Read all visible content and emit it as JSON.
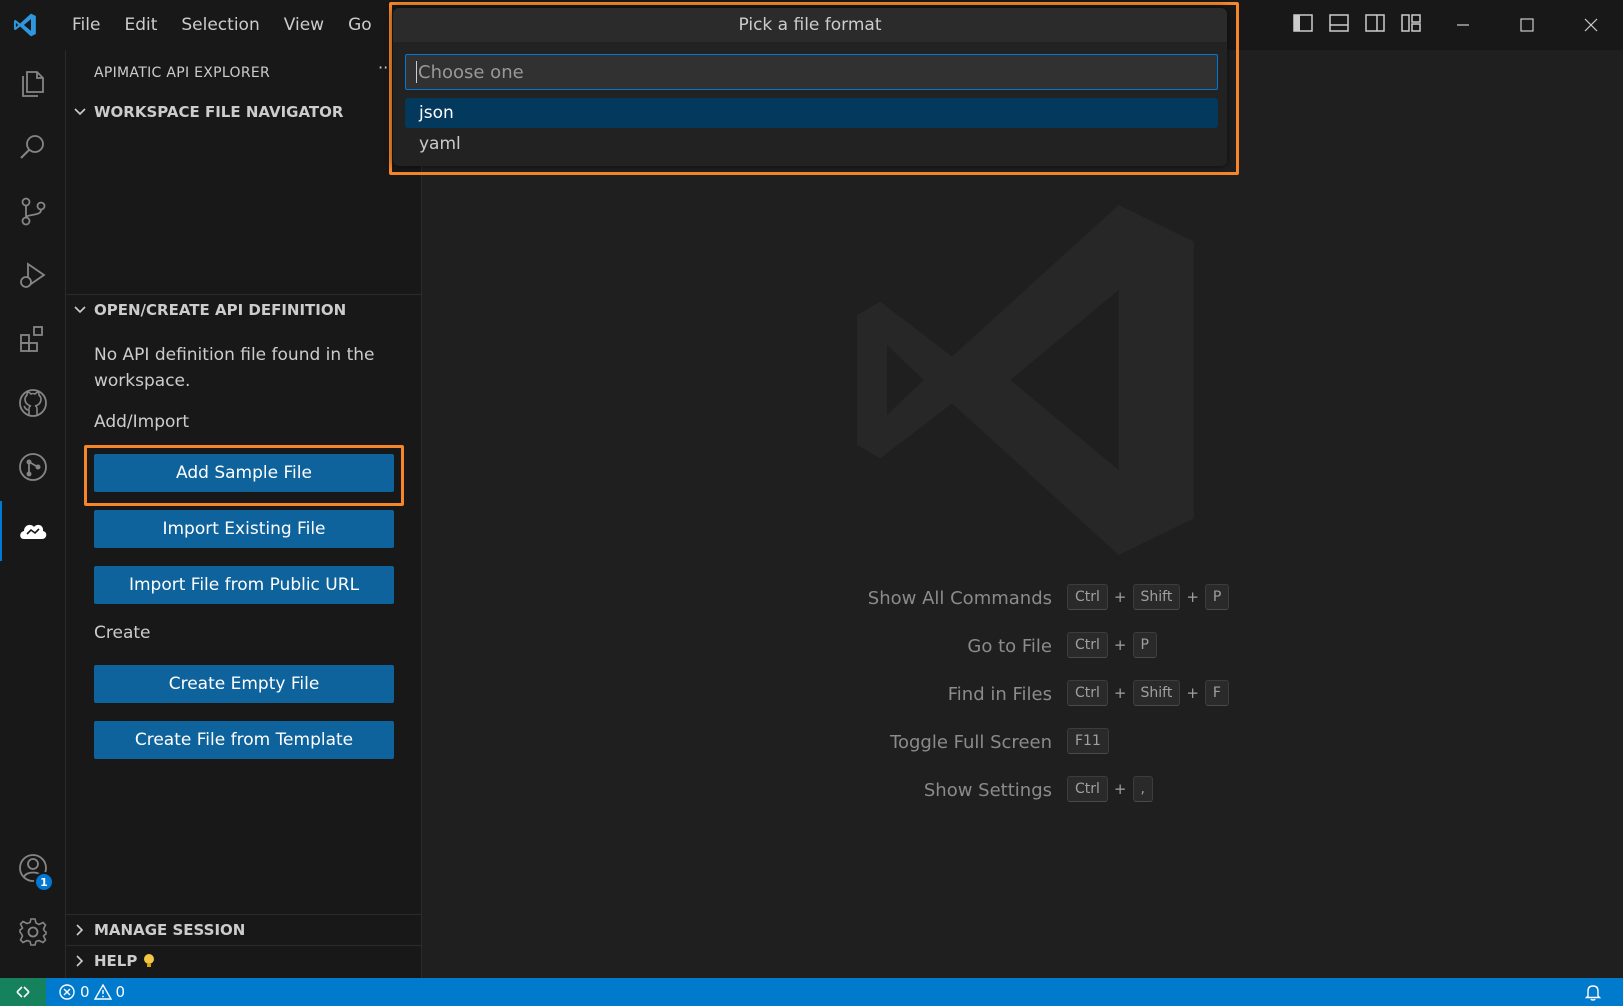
{
  "titlebar": {
    "menu": [
      "File",
      "Edit",
      "Selection",
      "View",
      "Go"
    ],
    "more": "···"
  },
  "sidebar": {
    "title": "APIMATIC API EXPLORER",
    "more": "···",
    "sections": {
      "workspace": "WORKSPACE FILE NAVIGATOR",
      "open_create": "OPEN/CREATE API DEFINITION",
      "manage": "MANAGE SESSION",
      "help": "HELP"
    },
    "empty_message": "No API definition file found in the workspace.",
    "add_import_label": "Add/Import",
    "create_label": "Create",
    "buttons": {
      "add_sample": "Add Sample File",
      "import_existing": "Import Existing File",
      "import_url": "Import File from Public URL",
      "create_empty": "Create Empty File",
      "create_template": "Create File from Template"
    },
    "help_icon": "lightbulb-icon"
  },
  "activitybar": {
    "accounts_badge": "1"
  },
  "quickpick": {
    "title": "Pick a file format",
    "placeholder": "Choose one",
    "options": [
      "json",
      "yaml"
    ],
    "selected": "json"
  },
  "editor": {
    "shortcuts": [
      {
        "label": "Show All Commands",
        "keys": [
          "Ctrl",
          "Shift",
          "P"
        ]
      },
      {
        "label": "Go to File",
        "keys": [
          "Ctrl",
          "P"
        ]
      },
      {
        "label": "Find in Files",
        "keys": [
          "Ctrl",
          "Shift",
          "F"
        ]
      },
      {
        "label": "Toggle Full Screen",
        "keys": [
          "F11"
        ]
      },
      {
        "label": "Show Settings",
        "keys": [
          "Ctrl",
          ","
        ]
      }
    ]
  },
  "statusbar": {
    "errors": "0",
    "warnings": "0"
  },
  "colors": {
    "accent": "#0078d4",
    "button": "#0e639c",
    "statusbar": "#007acc",
    "remote": "#16825d",
    "highlight": "#f5862a"
  }
}
